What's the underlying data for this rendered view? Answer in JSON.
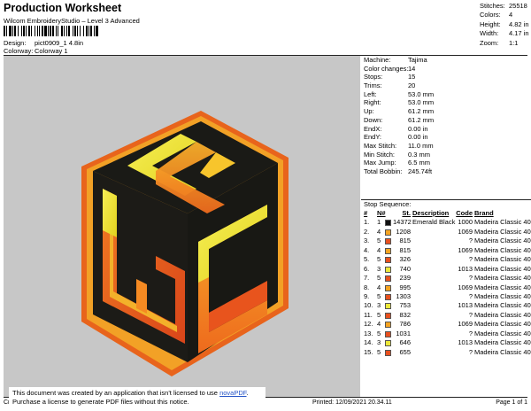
{
  "header": {
    "title": "Production Worksheet",
    "software": "Wilcom EmbroideryStudio – Level 3 Advanced",
    "design_label": "Design:",
    "design_value": "pict0909_1 4.8in",
    "colorway_label": "Colorway:",
    "colorway_value": "Colorway 1"
  },
  "summary": [
    {
      "label": "Stitches:",
      "value": "25518"
    },
    {
      "label": "Colors:",
      "value": "4"
    },
    {
      "label": "Height:",
      "value": "4.82 in"
    },
    {
      "label": "Width:",
      "value": "4.17 in"
    },
    {
      "label": "Zoom:",
      "value": "1:1"
    }
  ],
  "params": [
    {
      "label": "Machine:",
      "value": "Tajima"
    },
    {
      "label": "Color changes:",
      "value": "14"
    },
    {
      "label": "Stops:",
      "value": "15"
    },
    {
      "label": "Trims:",
      "value": "20"
    },
    {
      "label": "Left:",
      "value": "53.0 mm"
    },
    {
      "label": "Right:",
      "value": "53.0 mm"
    },
    {
      "label": "Up:",
      "value": "61.2 mm"
    },
    {
      "label": "Down:",
      "value": "61.2 mm"
    },
    {
      "label": "EndX:",
      "value": "0.00 in"
    },
    {
      "label": "EndY:",
      "value": "0.00 in"
    },
    {
      "label": "Max Stitch:",
      "value": "11.0 mm"
    },
    {
      "label": "Min Stitch:",
      "value": "0.3 mm"
    },
    {
      "label": "Max Jump:",
      "value": "6.5 mm"
    },
    {
      "label": "Total Bobbin:",
      "value": "245.74ft"
    }
  ],
  "stop_sequence": {
    "title": "Stop Sequence:",
    "headers": {
      "num": "#",
      "n": "N#",
      "st": "St.",
      "desc": "Description",
      "code": "Code",
      "brand": "Brand"
    },
    "rows": [
      {
        "num": "1.",
        "n": "1",
        "color": "#111111",
        "st": "14372",
        "desc": "Emerald Black",
        "code": "1000",
        "brand": "Madeira Classic 40"
      },
      {
        "num": "2.",
        "n": "4",
        "color": "#f5a422",
        "st": "1208",
        "desc": "",
        "code": "1069",
        "brand": "Madeira Classic 40"
      },
      {
        "num": "3.",
        "n": "5",
        "color": "#e8501e",
        "st": "815",
        "desc": "",
        "code": "?",
        "brand": "Madeira Classic 40"
      },
      {
        "num": "4.",
        "n": "4",
        "color": "#f5a422",
        "st": "815",
        "desc": "",
        "code": "1069",
        "brand": "Madeira Classic 40"
      },
      {
        "num": "5.",
        "n": "5",
        "color": "#e8501e",
        "st": "326",
        "desc": "",
        "code": "?",
        "brand": "Madeira Classic 40"
      },
      {
        "num": "6.",
        "n": "3",
        "color": "#ece83a",
        "st": "740",
        "desc": "",
        "code": "1013",
        "brand": "Madeira Classic 40"
      },
      {
        "num": "7.",
        "n": "5",
        "color": "#e8501e",
        "st": "239",
        "desc": "",
        "code": "?",
        "brand": "Madeira Classic 40"
      },
      {
        "num": "8.",
        "n": "4",
        "color": "#f5a422",
        "st": "995",
        "desc": "",
        "code": "1069",
        "brand": "Madeira Classic 40"
      },
      {
        "num": "9.",
        "n": "5",
        "color": "#e8501e",
        "st": "1303",
        "desc": "",
        "code": "?",
        "brand": "Madeira Classic 40"
      },
      {
        "num": "10.",
        "n": "3",
        "color": "#ece83a",
        "st": "753",
        "desc": "",
        "code": "1013",
        "brand": "Madeira Classic 40"
      },
      {
        "num": "11.",
        "n": "5",
        "color": "#e8501e",
        "st": "832",
        "desc": "",
        "code": "?",
        "brand": "Madeira Classic 40"
      },
      {
        "num": "12.",
        "n": "4",
        "color": "#f5a422",
        "st": "786",
        "desc": "",
        "code": "1069",
        "brand": "Madeira Classic 40"
      },
      {
        "num": "13.",
        "n": "5",
        "color": "#e8501e",
        "st": "1031",
        "desc": "",
        "code": "?",
        "brand": "Madeira Classic 40"
      },
      {
        "num": "14.",
        "n": "3",
        "color": "#ece83a",
        "st": "646",
        "desc": "",
        "code": "1013",
        "brand": "Madeira Classic 40"
      },
      {
        "num": "15.",
        "n": "5",
        "color": "#e8501e",
        "st": "655",
        "desc": "",
        "code": "?",
        "brand": "Madeira Classic 40"
      }
    ]
  },
  "footer": {
    "left": "Cr",
    "printed": "Printed: 12/09/2021 20.34.11",
    "page": "Page 1 of 1"
  },
  "nova_notice": {
    "line1_prefix": "This document was created by an application that isn't licensed to use ",
    "link": "novaPDF",
    "line1_suffix": ".",
    "line2": "Purchase a license to generate PDF files without this notice."
  },
  "colors": {
    "background": "#c7c7c7",
    "black": "#111111",
    "orange": "#f5a422",
    "red_orange": "#e8501e",
    "yellow": "#ece83a"
  }
}
